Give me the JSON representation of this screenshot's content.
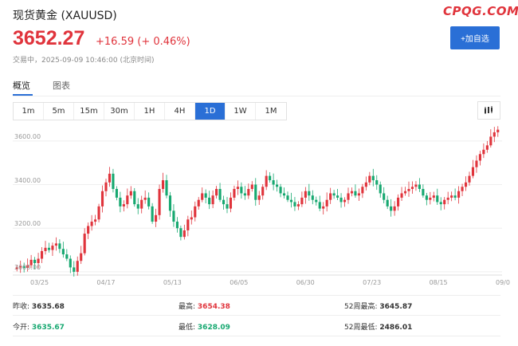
{
  "header": {
    "title": "现货黄金 (XAUUSD)",
    "price": "3652.27",
    "change": "+16.59 (+ 0.46%)",
    "status": "交易中，2025-09-09 10:46:00 (北京时间)",
    "add_label": "+加自选"
  },
  "watermark": "CPQG.COM",
  "tabs": [
    "概览",
    "图表"
  ],
  "ranges": [
    "1m",
    "5m",
    "15m",
    "30m",
    "1H",
    "4H",
    "1D",
    "1W",
    "1M"
  ],
  "active_range": "1D",
  "chart_data": {
    "type": "candlestick",
    "y_ticks": [
      "3600.00",
      "3400.00",
      "3200.00",
      "3000.00"
    ],
    "x_ticks": [
      "03/25",
      "04/17",
      "05/13",
      "06/05",
      "06/30",
      "07/23",
      "08/15",
      "09/0"
    ],
    "ylim": [
      2985,
      3680
    ],
    "series_close": [
      3020,
      3025,
      3018,
      3030,
      3055,
      3040,
      3060,
      3095,
      3110,
      3100,
      3120,
      3130,
      3105,
      3080,
      3060,
      3020,
      3000,
      3050,
      3085,
      3175,
      3210,
      3230,
      3240,
      3300,
      3370,
      3410,
      3450,
      3380,
      3340,
      3300,
      3310,
      3350,
      3370,
      3310,
      3290,
      3330,
      3340,
      3300,
      3230,
      3260,
      3380,
      3420,
      3350,
      3280,
      3230,
      3200,
      3160,
      3190,
      3240,
      3250,
      3300,
      3330,
      3360,
      3340,
      3310,
      3350,
      3380,
      3330,
      3310,
      3290,
      3340,
      3380,
      3390,
      3360,
      3350,
      3380,
      3400,
      3330,
      3350,
      3390,
      3440,
      3420,
      3400,
      3390,
      3360,
      3350,
      3330,
      3320,
      3300,
      3310,
      3340,
      3370,
      3350,
      3330,
      3320,
      3290,
      3300,
      3330,
      3360,
      3350,
      3340,
      3320,
      3330,
      3360,
      3370,
      3350,
      3360,
      3390,
      3410,
      3440,
      3420,
      3400,
      3360,
      3330,
      3300,
      3280,
      3300,
      3340,
      3360,
      3370,
      3380,
      3390,
      3400,
      3380,
      3350,
      3330,
      3340,
      3350,
      3320,
      3310,
      3330,
      3340,
      3350,
      3340,
      3370,
      3390,
      3410,
      3440,
      3480,
      3510,
      3540,
      3560,
      3580,
      3620,
      3640,
      3652
    ],
    "series_high": [
      null
    ]
  },
  "stats": {
    "prev_close_label": "昨收:",
    "prev_close": "3635.68",
    "high_label": "最高:",
    "high": "3654.38",
    "w52_high_label": "52周最高:",
    "w52_high": "3645.87",
    "open_label": "今开:",
    "open": "3635.67",
    "low_label": "最低:",
    "low": "3628.09",
    "w52_low_label": "52周最低:",
    "w52_low": "2486.01"
  },
  "colors": {
    "up": "#e0343c",
    "down": "#16a870",
    "accent": "#2a6fd6"
  }
}
